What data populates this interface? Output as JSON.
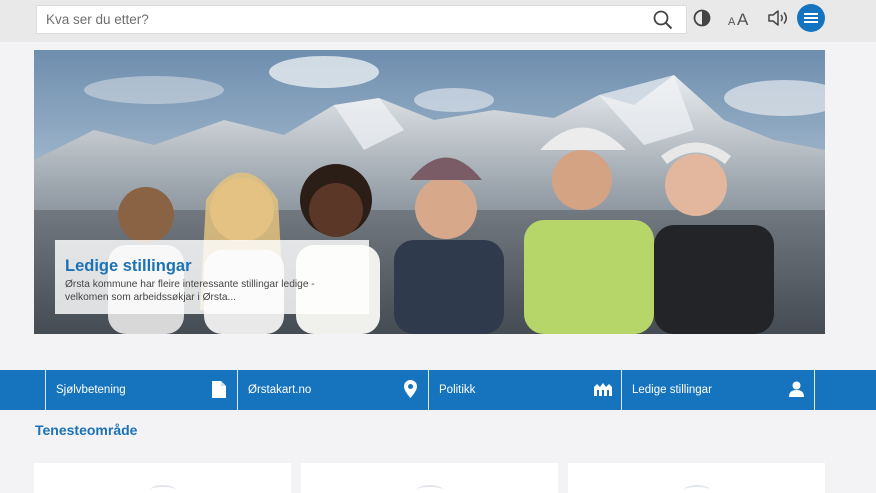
{
  "search": {
    "placeholder": "Kva ser du etter?",
    "icon": "search-icon"
  },
  "tools": {
    "contrast_icon": "contrast-icon",
    "text_size_label": "AA",
    "sound_icon": "speaker-icon",
    "menu_icon": "hamburger-menu-icon",
    "accent_color": "#1574c0"
  },
  "hero": {
    "title": "Ledige stillingar",
    "text": "Ørsta kommune har fleire interessante stillingar ledige - velkomen som arbeidssøkjar i Ørsta..."
  },
  "quick_links": [
    {
      "label": "Sjølvbetening",
      "icon": "document-icon"
    },
    {
      "label": "Ørstakart.no",
      "icon": "map-pin-icon"
    },
    {
      "label": "Politikk",
      "icon": "parliament-icon"
    },
    {
      "label": "Ledige stillingar",
      "icon": "person-icon"
    }
  ],
  "colors": {
    "quickbar": "#1674bf",
    "heading": "#1b72b6"
  },
  "services": {
    "title": "Tenesteområde"
  }
}
